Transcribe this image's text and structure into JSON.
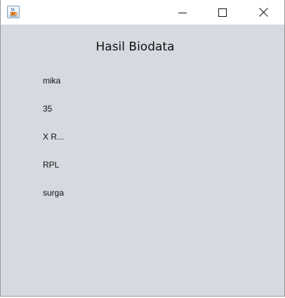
{
  "window": {
    "icon": "java-cup-icon",
    "buttons": {
      "minimize": "minimize-icon",
      "maximize": "maximize-icon",
      "close": "close-icon"
    }
  },
  "content": {
    "title": "Hasil Biodata",
    "fields": [
      "mika",
      "35",
      "X R...",
      "RPL",
      "surga"
    ]
  },
  "colors": {
    "panel_background": "#d6d9e0",
    "titlebar_background": "#ffffff"
  }
}
